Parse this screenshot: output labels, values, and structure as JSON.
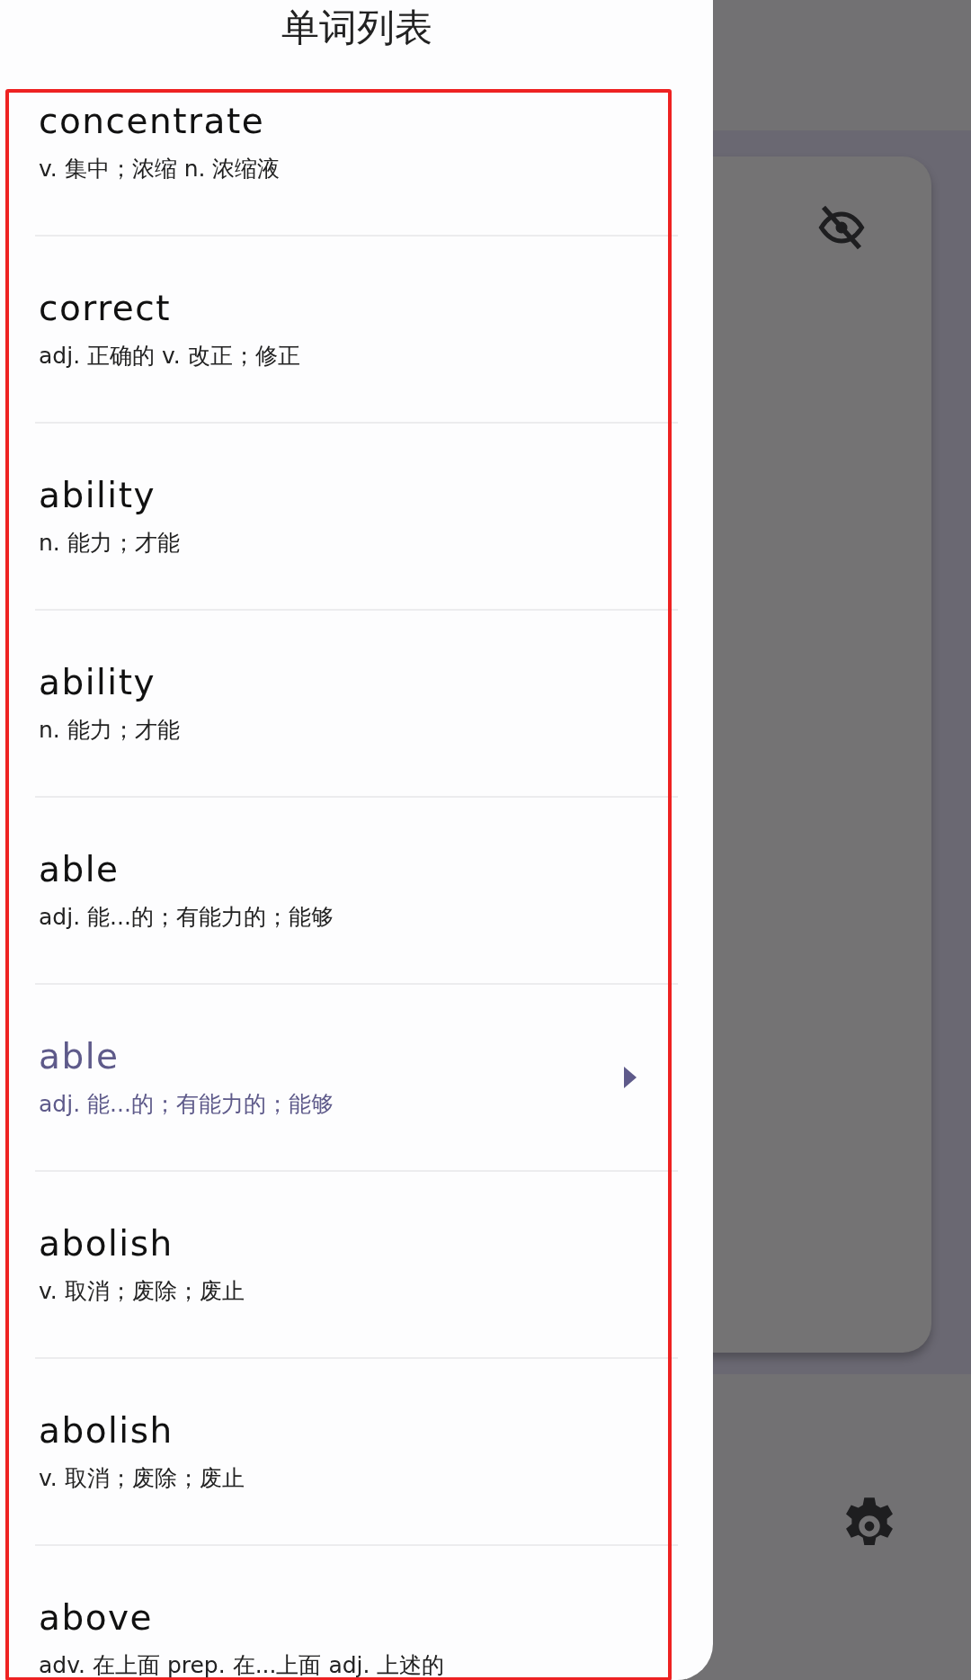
{
  "drawer": {
    "title": "单词列表",
    "words": [
      {
        "word": "concentrate",
        "definition": "v. 集中；浓缩  n. 浓缩液",
        "selected": false
      },
      {
        "word": "correct",
        "definition": "adj. 正确的  v. 改正；修正",
        "selected": false
      },
      {
        "word": "ability",
        "definition": "n. 能力；才能",
        "selected": false
      },
      {
        "word": "ability",
        "definition": "n. 能力；才能",
        "selected": false
      },
      {
        "word": "able",
        "definition": "adj. 能...的；有能力的；能够",
        "selected": false
      },
      {
        "word": "able",
        "definition": "adj. 能...的；有能力的；能够",
        "selected": true
      },
      {
        "word": "abolish",
        "definition": "v. 取消；废除；废止",
        "selected": false
      },
      {
        "word": "abolish",
        "definition": "v. 取消；废除；废止",
        "selected": false
      },
      {
        "word": "above",
        "definition": "adv. 在上面  prep. 在...上面  adj. 上述的",
        "selected": false
      }
    ]
  }
}
